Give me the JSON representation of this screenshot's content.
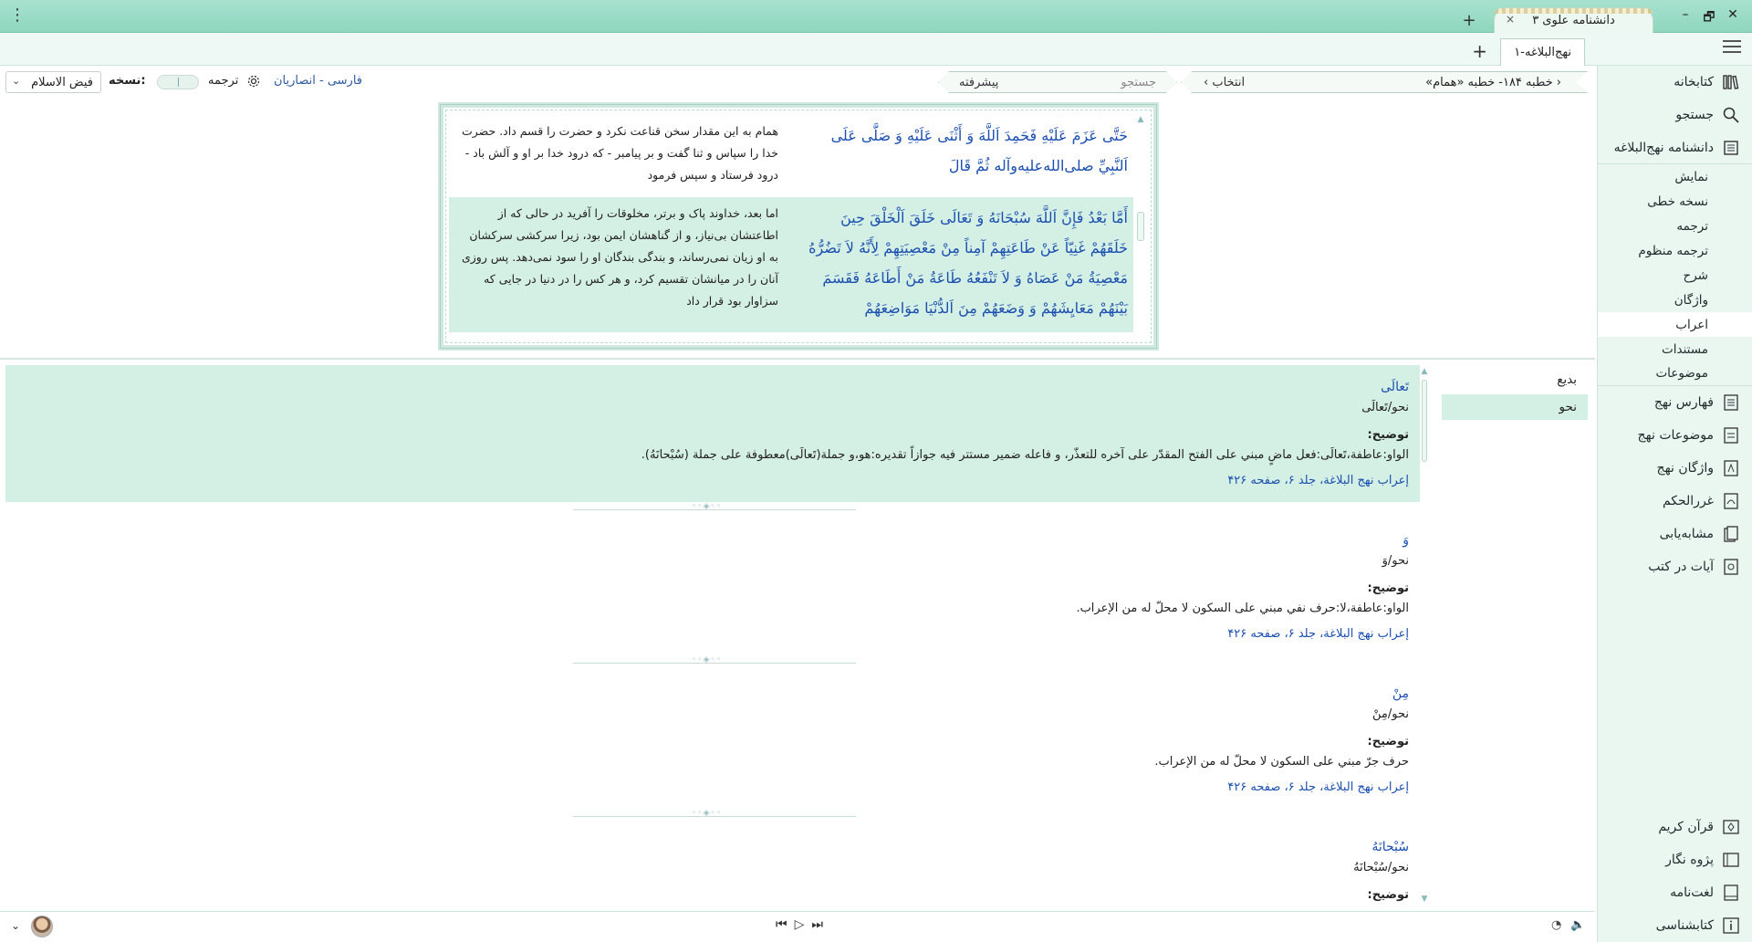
{
  "window": {
    "app_tab_title": "دانشنامه علوی ۳",
    "close": "×",
    "new_tab": "+",
    "min": "–",
    "max": "🗗",
    "win_close": "✕",
    "menu": "⋮"
  },
  "doc_tabs": {
    "active": "نهج‌البلاغه-۱",
    "add": "+"
  },
  "sidebar": {
    "top_items": [
      {
        "label": "کتابخانه",
        "icon": "library-icon"
      },
      {
        "label": "جستجو",
        "icon": "search-icon"
      },
      {
        "label": "دانشنامه نهج‌البلاغه",
        "icon": "encyclopedia-icon"
      }
    ],
    "sub_items": [
      "نمایش",
      "نسخه خطی",
      "ترجمه",
      "ترجمه منظوم",
      "شرح",
      "واژگان",
      "اعراب",
      "مستندات",
      "موضوعات"
    ],
    "active_sub": 6,
    "lower_items": [
      {
        "label": "فهارس نهج",
        "icon": "index-icon"
      },
      {
        "label": "موضوعات نهج",
        "icon": "topics-icon"
      },
      {
        "label": "واژگان نهج",
        "icon": "vocabulary-icon"
      },
      {
        "label": "غررالحکم",
        "icon": "ghurar-icon"
      },
      {
        "label": "مشابه‌یابی",
        "icon": "similar-icon"
      },
      {
        "label": "آیات در کتب",
        "icon": "verses-icon"
      }
    ],
    "bottom_items": [
      {
        "label": "قرآن کریم",
        "icon": "quran-icon"
      },
      {
        "label": "پژوه نگار",
        "icon": "research-icon"
      },
      {
        "label": "لغت‌نامه",
        "icon": "dictionary-icon"
      },
      {
        "label": "کتابشناسی",
        "icon": "info-icon"
      }
    ]
  },
  "toolbar": {
    "breadcrumb": "خطبه ۱۸۴- خطبه «همام»",
    "select_label": "انتخاب",
    "search_placeholder": "جستجو",
    "advanced": "پیشرفته",
    "language": "فارسی - انصاریان",
    "translation_label": "ترجمه",
    "version_label": "نسخه:",
    "version_value": "فیض الاسلام"
  },
  "text_panel": {
    "segments": [
      {
        "arabic": "حَتَّى عَزَمَ عَلَيْهِ فَحَمِدَ اَللَّهَ وَ أَثْنَى عَلَيْهِ وَ صَلَّى عَلَى اَلنَّبِيِّ صلى‌الله‌عليه‌وآله ثُمَّ قَالَ",
        "persian": "همام به این مقدار سخن قناعت نکرد و حضرت را قسم داد. حضرت خدا را سپاس و ثنا گفت و بر پیامبر - که درود خدا بر او و آلش باد - درود فرستاد و سپس فرمود"
      },
      {
        "arabic": "أَمَّا بَعْدُ فَإِنَّ اَللَّهَ سُبْحَانَهُ وَ تَعَالَى خَلَقَ اَلْخَلْقَ حِينَ خَلَقَهُمْ غَنِيّاً عَنْ طَاعَتِهِمْ آمِناً مِنْ مَعْصِيَتِهِمْ لِأَنَّهُ لاَ تَضُرُّهُ مَعْصِيَةُ مَنْ عَصَاهُ وَ لاَ تَنْفَعُهُ طَاعَةُ مَنْ أَطَاعَهُ فَقَسَمَ بَيْنَهُمْ مَعَايِشَهُمْ وَ وَضَعَهُمْ مِنَ اَلدُّنْيَا مَوَاضِعَهُمْ",
        "persian": "اما بعد، خداوند پاک و برتر، مخلوقات را آفرید در حالی که از اطاعتشان بی‌نیاز، و از گناهشان ایمن بود، زیرا سرکشی سرکشان به او زیان نمی‌رساند، و بندگی بندگان او را سود نمی‌دهد. پس روزی آنان را در میانشان تقسیم کرد، و هر کس را در دنیا در جایی که سزاوار بود قرار داد"
      }
    ]
  },
  "categories": [
    "بدیع",
    "نحو"
  ],
  "active_category": 1,
  "entries": [
    {
      "word": "تَعالَی",
      "path": "نحو/تَعالَی",
      "label": "توضیح:",
      "desc": "الواو:عاطفة،تَعالَی:فعل ماضٍ مبني علی الفتح المقدّر علی آخره للتعذّر، و فاعله ضمیر مستتر فیه جوازاً تقدیره:هو،و جملة(تَعالَی)معطوفة علی جملة (سُبْحانَهُ).",
      "ref": "إعراب نهج البلاغة، جلد ۶، صفحه ۴۲۶"
    },
    {
      "word": "وَ",
      "path": "نحو/وَ",
      "label": "توضیح:",
      "desc": "الواو:عاطفة،لا:حرف نفي مبني علی السکون لا محلّ له من الإعراب.",
      "ref": "إعراب نهج البلاغة، جلد ۶، صفحه ۴۲۶"
    },
    {
      "word": "مِنْ",
      "path": "نحو/مِنْ",
      "label": "توضیح:",
      "desc": "حرف جرّ مبني علی السکون لا محلّ له من الإعراب.",
      "ref": "إعراب نهج البلاغة، جلد ۶، صفحه ۴۲۶"
    },
    {
      "word": "سُبْحانَهُ",
      "path": "نحو/سُبْحانَهُ",
      "label": "توضیح:",
      "desc": "",
      "ref": ""
    }
  ],
  "bottom": {
    "chevron": "⌄",
    "prev": "⏮",
    "play": "▷",
    "next": "⏭",
    "speed": "◔",
    "volume": "🔈"
  }
}
